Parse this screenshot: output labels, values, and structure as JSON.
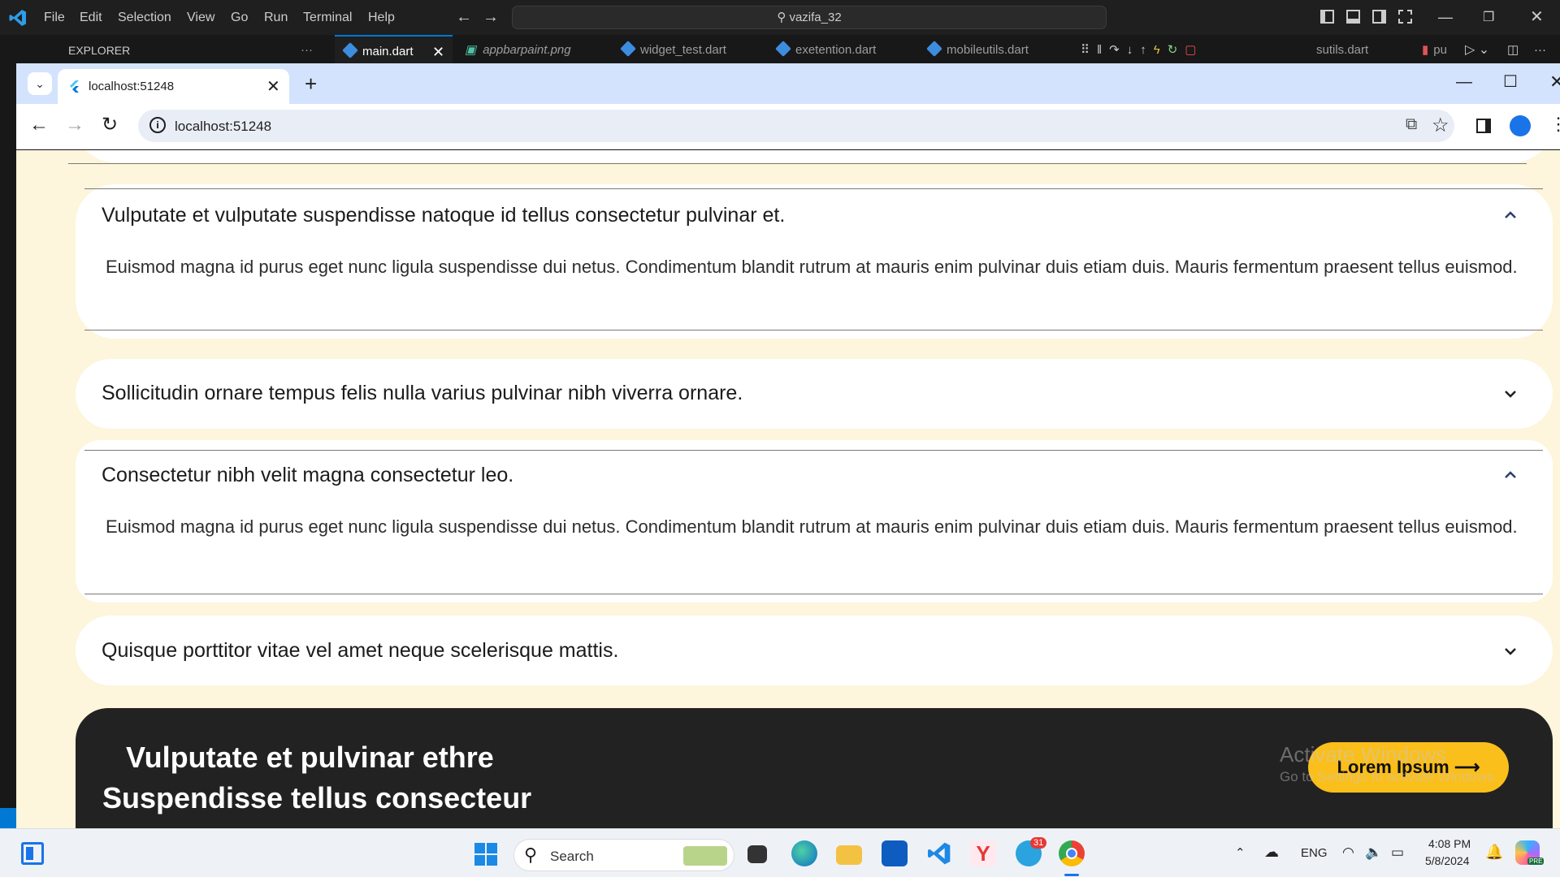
{
  "vscode": {
    "menu": [
      "File",
      "Edit",
      "Selection",
      "View",
      "Go",
      "Run",
      "Terminal",
      "Help"
    ],
    "command_center": "vazifa_32",
    "explorer_label": "EXPLORER",
    "explorer_more": "···",
    "tabs": [
      {
        "label": "main.dart",
        "active": true
      },
      {
        "label": "appbarpaint.png",
        "active": false
      },
      {
        "label": "widget_test.dart",
        "active": false
      },
      {
        "label": "exetention.dart",
        "active": false
      },
      {
        "label": "mobileutils.dart",
        "active": false
      },
      {
        "label": "sutils.dart",
        "active": false
      },
      {
        "label": "pu",
        "active": false
      }
    ]
  },
  "browser": {
    "tab_title": "localhost:51248",
    "url": "localhost:51248",
    "new_tab": "+"
  },
  "faq": {
    "items": [
      {
        "question": "Vulputate et vulputate suspendisse natoque id tellus consectetur pulvinar et.",
        "answer": "Euismod magna id purus eget nunc ligula suspendisse dui netus. Condimentum blandit rutrum at mauris enim pulvinar duis etiam duis. Mauris fermentum praesent tellus euismod.",
        "expanded": true
      },
      {
        "question": "Sollicitudin ornare tempus felis nulla varius pulvinar nibh viverra ornare.",
        "answer": "",
        "expanded": false
      },
      {
        "question": "Consectetur nibh velit magna consectetur leo.",
        "answer": "Euismod magna id purus eget nunc ligula suspendisse dui netus. Condimentum blandit rutrum at mauris enim pulvinar duis etiam duis. Mauris fermentum praesent tellus euismod.",
        "expanded": true
      },
      {
        "question": "Quisque porttitor vitae vel amet neque scelerisque mattis.",
        "answer": "",
        "expanded": false
      }
    ]
  },
  "footer": {
    "line1": "Vulputate et pulvinar ethre",
    "line2": "Suspendisse tellus consecteur",
    "cta": "Lorem Ipsum ⟶",
    "watermark_title": "Activate Windows",
    "watermark_sub": "Go to Settings to activate Windows."
  },
  "taskbar": {
    "search_label": "Search",
    "lang": "ENG",
    "time": "4:08 PM",
    "date": "5/8/2024",
    "telegram_badge": "31",
    "copilot_badge": "PRE"
  },
  "colors": {
    "page_bg": "#fdf5dc",
    "cta": "#fbbf1b",
    "footer_bg": "#222222",
    "accent": "#0078d4"
  }
}
